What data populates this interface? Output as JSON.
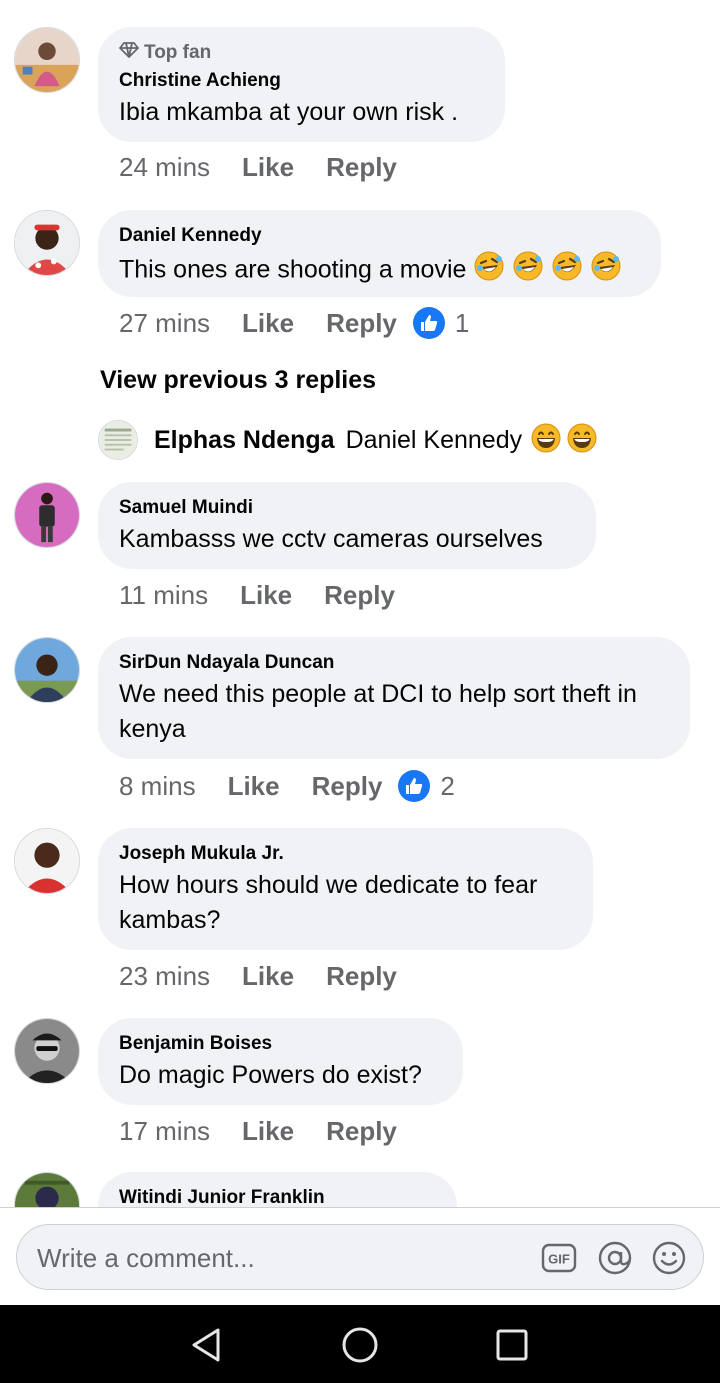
{
  "comments": [
    {
      "badge": "Top fan",
      "badge_icon": "diamond-icon",
      "author": "Christine Achieng",
      "text": "Ibia mkamba at your own risk .",
      "time": "24 mins",
      "like": "Like",
      "reply": "Reply"
    },
    {
      "author": "Daniel Kennedy",
      "text": "This ones are shooting a movie",
      "emojis": [
        "rolling-on-floor-laughing",
        "rolling-on-floor-laughing",
        "rolling-on-floor-laughing",
        "rolling-on-floor-laughing"
      ],
      "time": "27 mins",
      "like": "Like",
      "reply": "Reply",
      "reaction_count": "1"
    },
    {
      "author": "Samuel Muindi",
      "text": "Kambasss we cctv cameras ourselves",
      "time": "11 mins",
      "like": "Like",
      "reply": "Reply"
    },
    {
      "author": "SirDun Ndayala Duncan",
      "text_line1": "We need this people at DCI to help sort theft in",
      "text_line2": "kenya",
      "time": "8 mins",
      "like": "Like",
      "reply": "Reply",
      "reaction_count": "2"
    },
    {
      "author": "Joseph Mukula Jr.",
      "text_line1": "How hours should we dedicate to fear",
      "text_line2": "kambas?",
      "time": "23 mins",
      "like": "Like",
      "reply": "Reply"
    },
    {
      "author": "Benjamin Boises",
      "text": "Do magic Powers do exist?",
      "time": "17 mins",
      "like": "Like",
      "reply": "Reply"
    },
    {
      "author": "Witindi Junior Franklin"
    }
  ],
  "view_previous": "View previous 3 replies",
  "nested_reply": {
    "author": "Elphas Ndenga",
    "text": "Daniel Kennedy",
    "emojis": [
      "grinning-face",
      "grinning-face"
    ]
  },
  "composer": {
    "placeholder": "Write a comment...",
    "icons": [
      "gif-icon",
      "mention-icon",
      "emoji-icon"
    ]
  },
  "colors": {
    "bubble": "#f0f2f5",
    "meta": "#65676b",
    "like_blue": "#1877f2",
    "navbar": "#000000"
  },
  "navbar": {
    "icons": [
      "back-triangle-icon",
      "home-circle-icon",
      "recents-square-icon"
    ]
  }
}
